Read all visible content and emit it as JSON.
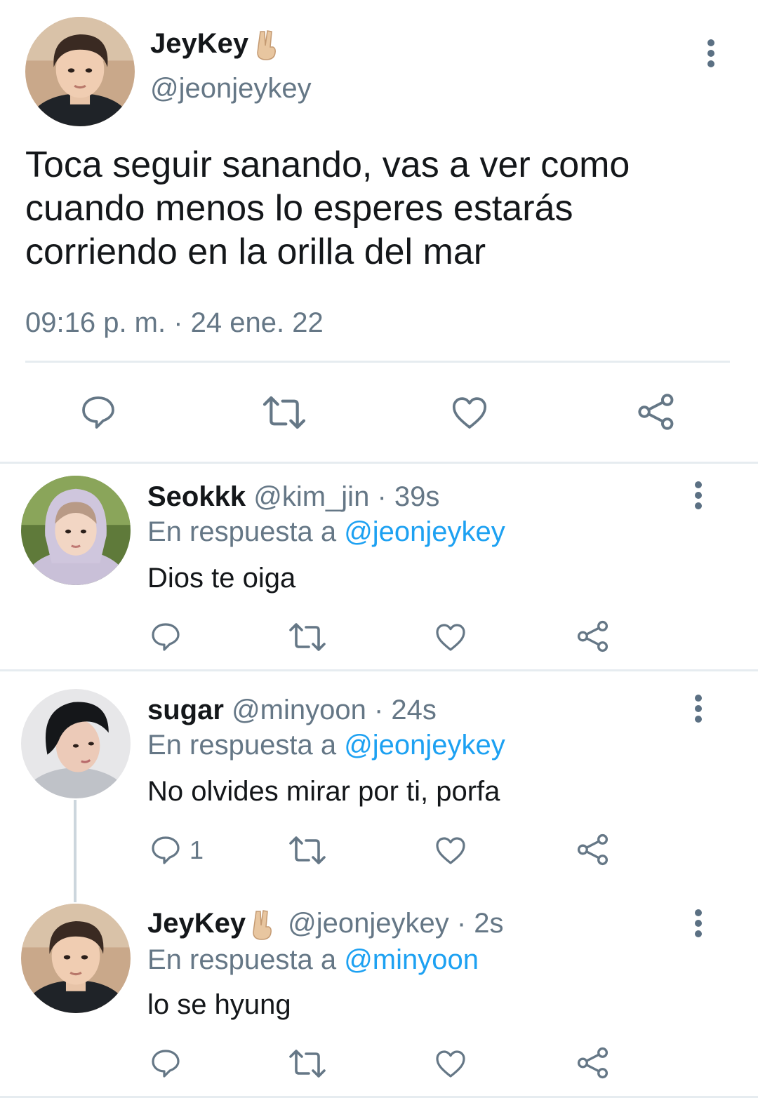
{
  "main_tweet": {
    "display_name": "JeyKey",
    "handle": "@jeonjeykey",
    "text": "Toca seguir sanando, vas a ver como cuando menos lo esperes estarás corriendo en la orilla del mar",
    "timestamp": "09:16 p. m. · 24 ene. 22"
  },
  "replies": [
    {
      "display_name": "Seokkk",
      "handle": "@kim_jin",
      "time": "· 39s",
      "reply_prefix": "En respuesta a",
      "reply_to": "@jeonjeykey",
      "text": "Dios te oiga",
      "reply_count": ""
    },
    {
      "display_name": "sugar",
      "handle": "@minyoon",
      "time": "· 24s",
      "reply_prefix": "En respuesta a",
      "reply_to": "@jeonjeykey",
      "text": "No olvides mirar por ti, porfa",
      "reply_count": "1"
    },
    {
      "display_name": "JeyKey",
      "handle": "@jeonjeykey",
      "time": "· 2s",
      "reply_prefix": "En respuesta a",
      "reply_to": "@minyoon",
      "text": "lo se hyung",
      "reply_count": ""
    }
  ],
  "icons": [
    "comment-icon",
    "retweet-icon",
    "like-icon",
    "share-icon",
    "more-icon",
    "victory-hand-emoji"
  ],
  "colors": {
    "link": "#1da1f2",
    "muted": "#657786",
    "icon": "#657786",
    "divider": "#e6ecf0"
  }
}
